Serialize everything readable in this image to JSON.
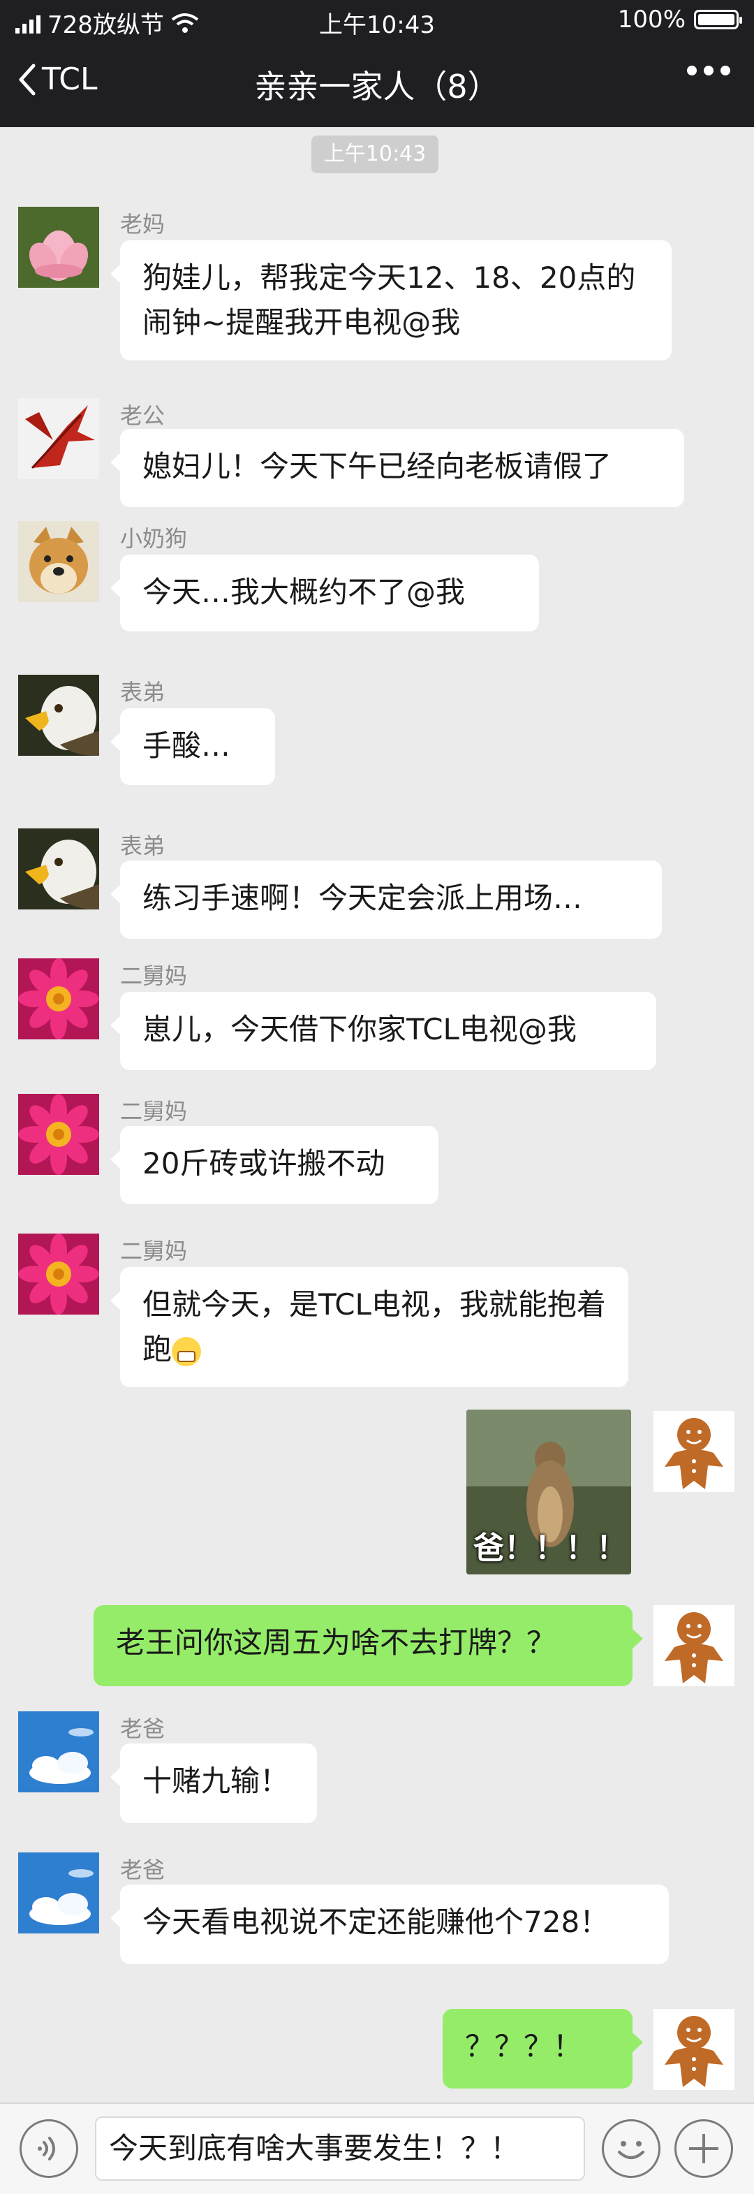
{
  "status_bar": {
    "carrier": "728放纵节",
    "time": "上午10:43",
    "battery": "100%",
    "battery_level": 1.0
  },
  "nav": {
    "back_label": "TCL",
    "title": "亲亲一家人（8）"
  },
  "timestamp": "上午10:43",
  "messages": [
    {
      "sender": "老妈",
      "avatar": "lotus-avatar",
      "side": "left",
      "text": "狗娃儿，帮我定今天12、18、20点的闹钟~提醒我开电视@我"
    },
    {
      "sender": "老公",
      "avatar": "red-leaf-avatar",
      "side": "left",
      "text": "媳妇儿！今天下午已经向老板请假了"
    },
    {
      "sender": "小奶狗",
      "avatar": "doge-avatar",
      "side": "left",
      "text": "今天…我大概约不了@我"
    },
    {
      "sender": "表弟",
      "avatar": "eagle-avatar",
      "side": "left",
      "text": "手酸…"
    },
    {
      "sender": "表弟",
      "avatar": "eagle-avatar",
      "side": "left",
      "text": "练习手速啊！今天定会派上用场…"
    },
    {
      "sender": "二舅妈",
      "avatar": "pink-flower-avatar",
      "side": "left",
      "text": "崽儿，今天借下你家TCL电视@我"
    },
    {
      "sender": "二舅妈",
      "avatar": "pink-flower-avatar",
      "side": "left",
      "text": "20斤砖或许搬不动"
    },
    {
      "sender": "二舅妈",
      "avatar": "pink-flower-avatar",
      "side": "left",
      "text": "但就今天，是TCL电视，我就能抱着跑",
      "emoji": "grimace-emoji"
    },
    {
      "sender": "",
      "avatar": "gingerbread-avatar",
      "side": "right",
      "sticker_text": "爸！！！！"
    },
    {
      "sender": "",
      "avatar": "gingerbread-avatar",
      "side": "right",
      "text": "老王问你这周五为啥不去打牌？？"
    },
    {
      "sender": "老爸",
      "avatar": "sky-avatar",
      "side": "left",
      "text": "十赌九输！"
    },
    {
      "sender": "老爸",
      "avatar": "sky-avatar",
      "side": "left",
      "text": "今天看电视说不定还能赚他个728！"
    },
    {
      "sender": "",
      "avatar": "gingerbread-avatar",
      "side": "right",
      "text": "？？？！"
    }
  ],
  "input": {
    "value": "今天到底有啥大事要发生！？！"
  },
  "colors": {
    "header_bg": "#1f1f23",
    "chat_bg": "#ebebeb",
    "bubble_self": "#95ec69",
    "bubble_other": "#ffffff"
  }
}
